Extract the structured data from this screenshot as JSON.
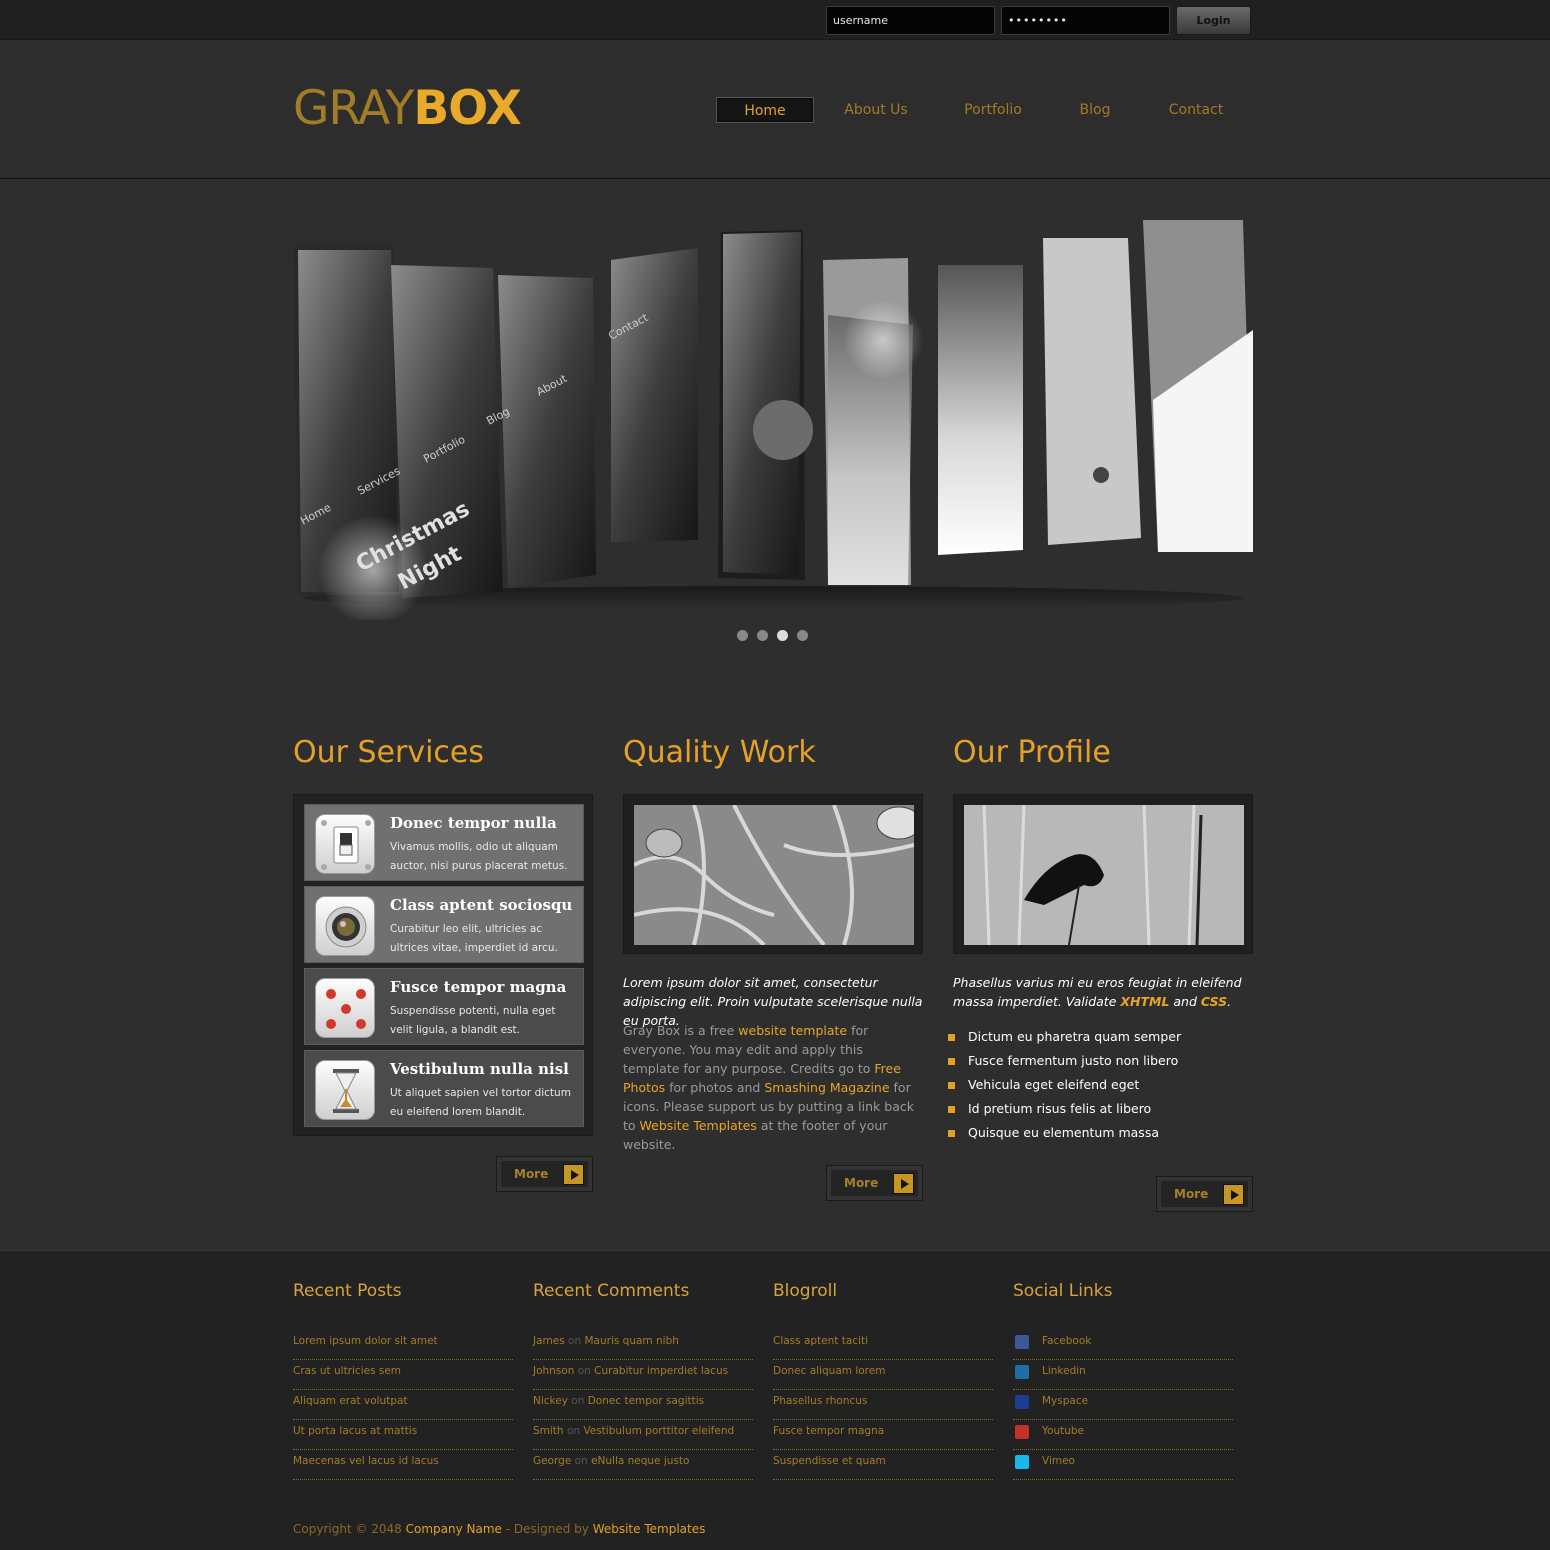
{
  "login": {
    "username_value": "username",
    "password_value": "••••••••",
    "button_label": "Login"
  },
  "logo": {
    "part1": "GRAY",
    "part2": "BOX"
  },
  "nav": [
    "Home",
    "About Us",
    "Portfolio",
    "Blog",
    "Contact"
  ],
  "slider": {
    "active_dot_index": 2,
    "dot_count": 4,
    "texts": [
      "Home",
      "Services",
      "Portfolio",
      "Blog",
      "About",
      "Contact",
      "Christmas",
      "Night",
      "Blog"
    ]
  },
  "services": {
    "title": "Our Services",
    "items": [
      {
        "title": "Donec tempor nulla",
        "text": "Vivamus mollis, odio ut aliquam auctor, nisi purus placerat metus.",
        "icon": "switch-icon"
      },
      {
        "title": "Class aptent sociosqu",
        "text": "Curabitur leo elit, ultricies ac ultrices vitae, imperdiet id arcu.",
        "icon": "camera-lens-icon"
      },
      {
        "title": "Fusce tempor magna",
        "text": "Suspendisse potenti, nulla eget velit ligula, a blandit est.",
        "icon": "dice-icon"
      },
      {
        "title": "Vestibulum nulla nisl",
        "text": "Ut aliquet sapien vel tortor dictum eu eleifend lorem blandit.",
        "icon": "hourglass-icon"
      }
    ],
    "more": "More"
  },
  "quality": {
    "title": "Quality Work",
    "lead": "Lorem ipsum dolor sit amet, consectetur adipiscing elit. Proin vulputate scelerisque nulla eu porta.",
    "body_1": "Gray Box is a free ",
    "link_1": "website template",
    "body_2": " for everyone. You may edit and apply this template for any purpose. Credits go to ",
    "link_2": "Free Photos",
    "body_3": " for photos and ",
    "link_3": "Smashing Magazine",
    "body_4": " for icons. Please support us by putting a link back to ",
    "link_4": "Website Templates",
    "body_5": " at the footer of your website.",
    "more": "More"
  },
  "profile": {
    "title": "Our Profile",
    "lead_1": "Phasellus varius mi eu eros feugiat in eleifend massa imperdiet. Validate ",
    "lead_xhtml": "XHTML",
    "lead_and": " and ",
    "lead_css": "CSS",
    "lead_end": ".",
    "bullets": [
      "Dictum eu pharetra quam semper",
      "Fusce fermentum justo non libero",
      "Vehicula eget eleifend eget",
      "Id pretium risus felis at libero",
      "Quisque eu elementum massa"
    ],
    "more": "More"
  },
  "footer": {
    "recent_posts": {
      "title": "Recent Posts",
      "items": [
        "Lorem ipsum dolor sit amet",
        "Cras ut ultricies sem",
        "Aliquam erat volutpat",
        "Ut porta lacus at mattis",
        "Maecenas vel lacus id lacus"
      ]
    },
    "recent_comments": {
      "title": "Recent Comments",
      "on": "on",
      "items": [
        {
          "author": "James",
          "post": "Mauris quam nibh"
        },
        {
          "author": "Johnson",
          "post": "Curabitur imperdiet lacus"
        },
        {
          "author": "Nickey",
          "post": "Donec tempor sagittis"
        },
        {
          "author": "Smith",
          "post": "Vestibulum porttitor eleifend"
        },
        {
          "author": "George",
          "post": "eNulla neque justo"
        }
      ]
    },
    "blogroll": {
      "title": "Blogroll",
      "items": [
        "Class aptent taciti",
        "Donec aliquam lorem",
        "Phasellus rhoncus",
        "Fusce tempor magna",
        "Suspendisse et quam"
      ]
    },
    "social": {
      "title": "Social Links",
      "items": [
        {
          "label": "Facebook",
          "icon": "facebook-icon",
          "color": "#3b5998"
        },
        {
          "label": "Linkedin",
          "icon": "linkedin-icon",
          "color": "#1d6fa5"
        },
        {
          "label": "Myspace",
          "icon": "myspace-icon",
          "color": "#1c3e91"
        },
        {
          "label": "Youtube",
          "icon": "youtube-icon",
          "color": "#c4302b"
        },
        {
          "label": "Vimeo",
          "icon": "vimeo-icon",
          "color": "#1ab7ea"
        }
      ]
    },
    "copyright_1": "Copyright © 2048 ",
    "company": "Company Name",
    "designed": " - Designed by ",
    "templates": "Website Templates"
  },
  "colors": {
    "accent": "#e3a127",
    "accent_dark": "#a37a22",
    "background": "#2b2b2b"
  }
}
